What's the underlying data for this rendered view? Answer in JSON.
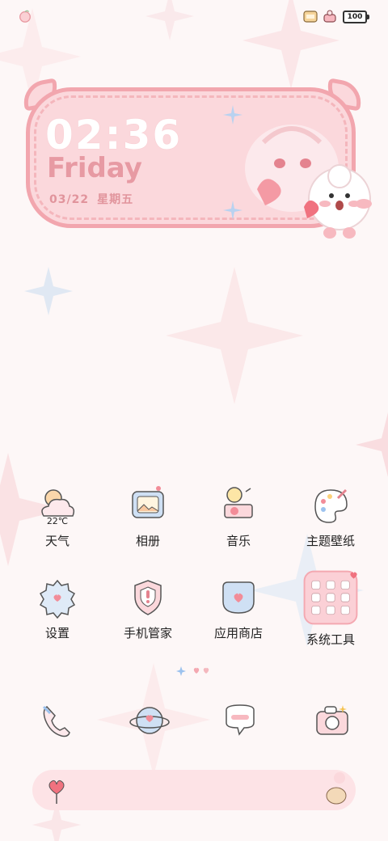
{
  "status_bar": {
    "battery": "100",
    "left_icon": "peach-icon",
    "right_icons": [
      "cookie-jar-icon",
      "cake-icon"
    ]
  },
  "clock_widget": {
    "time": "02:36",
    "day": "Friday",
    "date": "03/22",
    "weekday": "星期五"
  },
  "apps": [
    {
      "label": "天气",
      "icon": "weather-cloud-icon",
      "sub": "22℃"
    },
    {
      "label": "相册",
      "icon": "photo-frame-icon"
    },
    {
      "label": "音乐",
      "icon": "gramophone-icon"
    },
    {
      "label": "主题壁纸",
      "icon": "palette-icon"
    },
    {
      "label": "设置",
      "icon": "gear-icon"
    },
    {
      "label": "手机管家",
      "icon": "shield-icon"
    },
    {
      "label": "应用商店",
      "icon": "shopping-bag-icon"
    },
    {
      "label": "系统工具",
      "icon": "tools-folder-icon"
    }
  ],
  "dock": [
    {
      "icon": "phone-icon"
    },
    {
      "icon": "planet-browser-icon"
    },
    {
      "icon": "message-bubble-icon"
    },
    {
      "icon": "camera-icon"
    }
  ],
  "page_indicator": {
    "pages": 3,
    "current": 1
  },
  "colors": {
    "background": "#fdf7f7",
    "widget_fill": "#fbd8dc",
    "widget_border": "#f2a6ae",
    "accent_pink": "#f28c98",
    "accent_blue": "#bcd5ef"
  }
}
